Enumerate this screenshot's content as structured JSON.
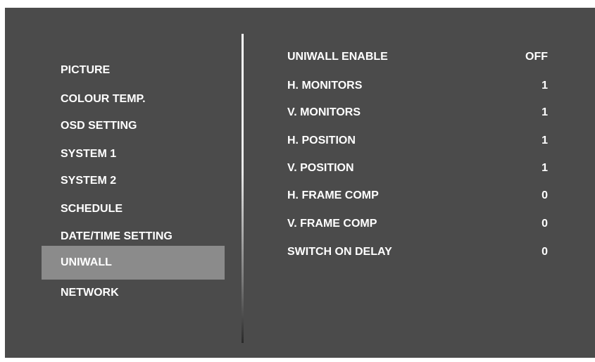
{
  "menu": {
    "items": [
      {
        "label": "PICTURE"
      },
      {
        "label": "COLOUR TEMP."
      },
      {
        "label": "OSD SETTING"
      },
      {
        "label": "SYSTEM 1"
      },
      {
        "label": "SYSTEM 2"
      },
      {
        "label": "SCHEDULE"
      },
      {
        "label": "DATE/TIME SETTING"
      },
      {
        "label": "UNIWALL"
      },
      {
        "label": "NETWORK"
      }
    ],
    "selected": "UNIWALL"
  },
  "settings": {
    "rows": [
      {
        "label": "UNIWALL ENABLE",
        "value": "OFF"
      },
      {
        "label": "H. MONITORS",
        "value": "1"
      },
      {
        "label": "V. MONITORS",
        "value": "1"
      },
      {
        "label": "H. POSITION",
        "value": "1"
      },
      {
        "label": "V. POSITION",
        "value": "1"
      },
      {
        "label": "H. FRAME COMP",
        "value": "0"
      },
      {
        "label": "V. FRAME COMP",
        "value": "0"
      },
      {
        "label": "SWITCH ON DELAY",
        "value": "0"
      }
    ]
  },
  "colors": {
    "background": "#4b4b4b",
    "selection": "#8b8b8b",
    "text": "#ffffff"
  }
}
